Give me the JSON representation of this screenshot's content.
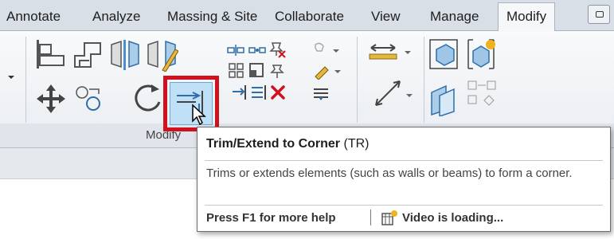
{
  "ribbon": {
    "tabs": [
      {
        "label": "Annotate"
      },
      {
        "label": "Analyze"
      },
      {
        "label": "Massing & Site"
      },
      {
        "label": "Collaborate"
      },
      {
        "label": "View"
      },
      {
        "label": "Manage"
      },
      {
        "label": "Modify",
        "active": true
      }
    ],
    "panel_title": "Modify"
  },
  "tooltip": {
    "title": "Trim/Extend to Corner",
    "shortcut": "(TR)",
    "description": "Trims or extends elements (such as walls or beams) to form a corner.",
    "help": "Press F1 for more help",
    "video": "Video is loading..."
  },
  "colors": {
    "highlight": "#d0121f",
    "tool_selected_bg": "#bfe0f7",
    "ribbon_bg": "#d9dfe7"
  },
  "icons": [
    "align-icon",
    "offset-icon",
    "mirror-pick-axis-icon",
    "mirror-draw-axis-icon",
    "split-element-icon",
    "split-with-gap-icon",
    "unpin-icon",
    "move-icon",
    "copy-icon",
    "rotate-icon",
    "trim-extend-corner-icon",
    "array-icon",
    "scale-icon",
    "pin-icon",
    "trim-extend-single-icon",
    "trim-extend-multiple-icon",
    "delete-icon",
    "paint-icon",
    "measure-icon",
    "create-parts-icon",
    "create-assembly-icon"
  ]
}
